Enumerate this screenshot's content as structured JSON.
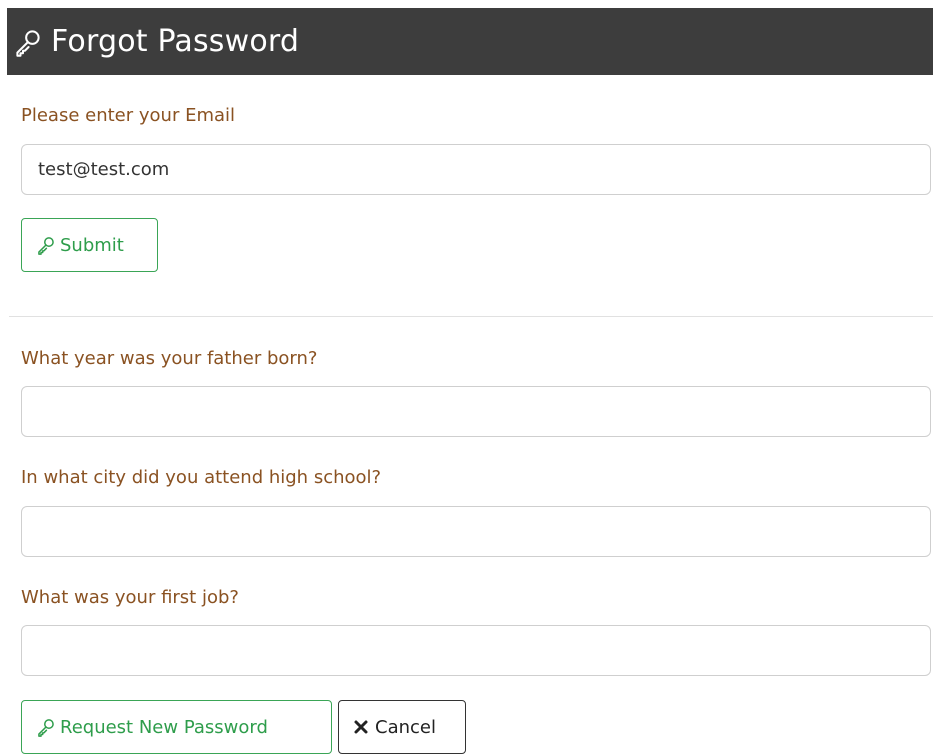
{
  "header": {
    "title": "Forgot Password",
    "icon": "key-icon"
  },
  "email_section": {
    "label": "Please enter your Email",
    "email_value": "test@test.com",
    "submit_label": "Submit",
    "submit_icon": "key-icon"
  },
  "security_questions": [
    {
      "label": "What year was your father born?",
      "value": ""
    },
    {
      "label": "In what city did you attend high school?",
      "value": ""
    },
    {
      "label": "What was your first job?",
      "value": ""
    }
  ],
  "actions": {
    "request_label": "Request New Password",
    "request_icon": "key-icon",
    "cancel_label": "Cancel",
    "cancel_icon": "close-icon"
  },
  "colors": {
    "header_bg": "#3d3d3d",
    "label_text": "#8a5222",
    "primary_green": "#2e9d4b"
  }
}
